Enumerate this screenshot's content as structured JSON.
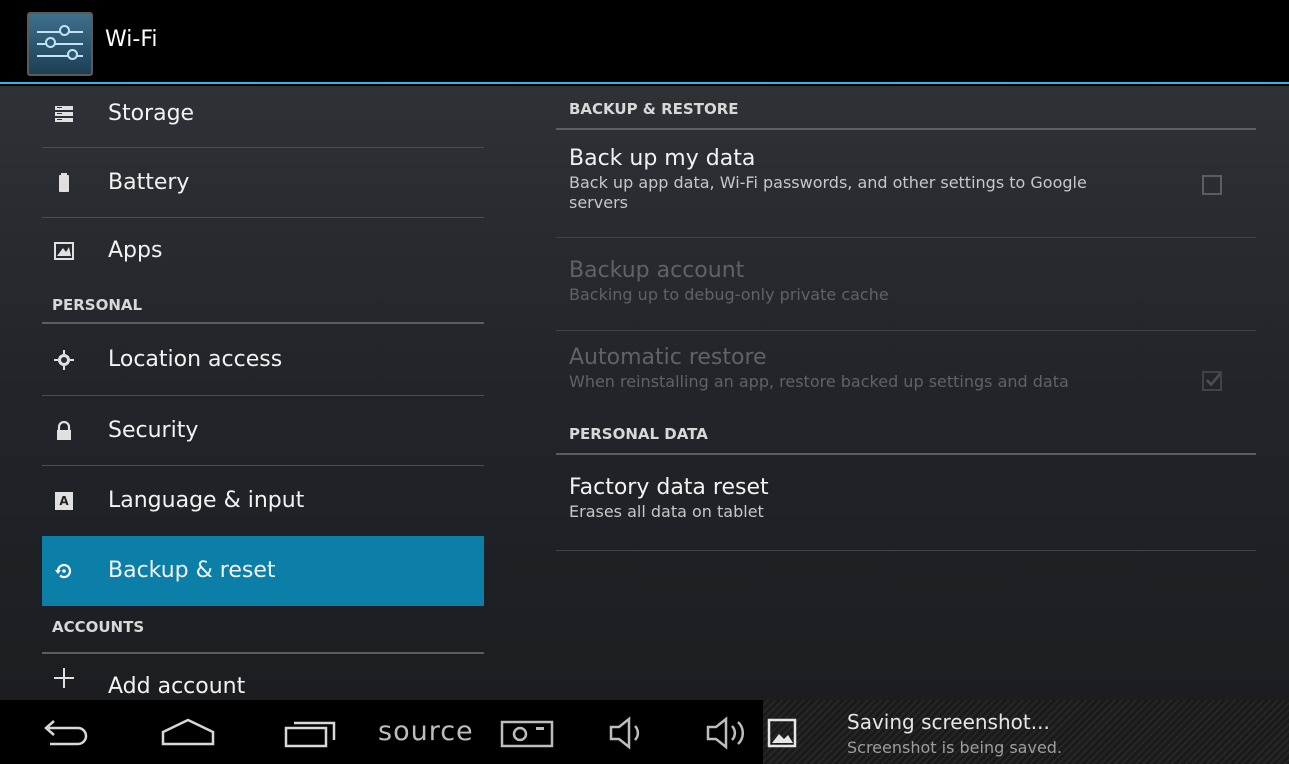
{
  "actionbar": {
    "title": "Wi-Fi"
  },
  "sidebar": {
    "items_top": [
      {
        "label": "Storage",
        "icon": "storage-icon"
      },
      {
        "label": "Battery",
        "icon": "battery-icon"
      },
      {
        "label": "Apps",
        "icon": "apps-icon"
      }
    ],
    "personal_header": "PERSONAL",
    "items_personal": [
      {
        "label": "Location access",
        "icon": "location-icon"
      },
      {
        "label": "Security",
        "icon": "lock-icon"
      },
      {
        "label": "Language & input",
        "icon": "keyboard-icon"
      },
      {
        "label": "Backup & reset",
        "icon": "backup-icon",
        "selected": true
      }
    ],
    "accounts_header": "ACCOUNTS",
    "add_account": "Add account"
  },
  "content": {
    "backup_header": "BACKUP & RESTORE",
    "backup_my_data": {
      "title": "Back up my data",
      "summary": "Back up app data, Wi-Fi passwords, and other settings to Google servers",
      "checked": false
    },
    "backup_account": {
      "title": "Backup account",
      "summary": "Backing up to debug-only private cache",
      "enabled": false
    },
    "auto_restore": {
      "title": "Automatic restore",
      "summary": "When reinstalling an app, restore backed up settings and data",
      "checked": true,
      "enabled": false
    },
    "personal_data_header": "PERSONAL DATA",
    "factory_reset": {
      "title": "Factory data reset",
      "summary": "Erases all data on tablet"
    }
  },
  "navbar": {
    "buttons": [
      "back-icon",
      "home-icon",
      "recents-icon",
      "screenshot-icon",
      "volume-down-icon",
      "volume-up-icon"
    ],
    "source_label": "source"
  },
  "notification": {
    "title": "Saving screenshot...",
    "text": "Screenshot is being saved.",
    "icon": "image-icon"
  },
  "colors": {
    "accent": "#33b5e5",
    "selected": "#0b7fa8",
    "background": "#000000"
  }
}
